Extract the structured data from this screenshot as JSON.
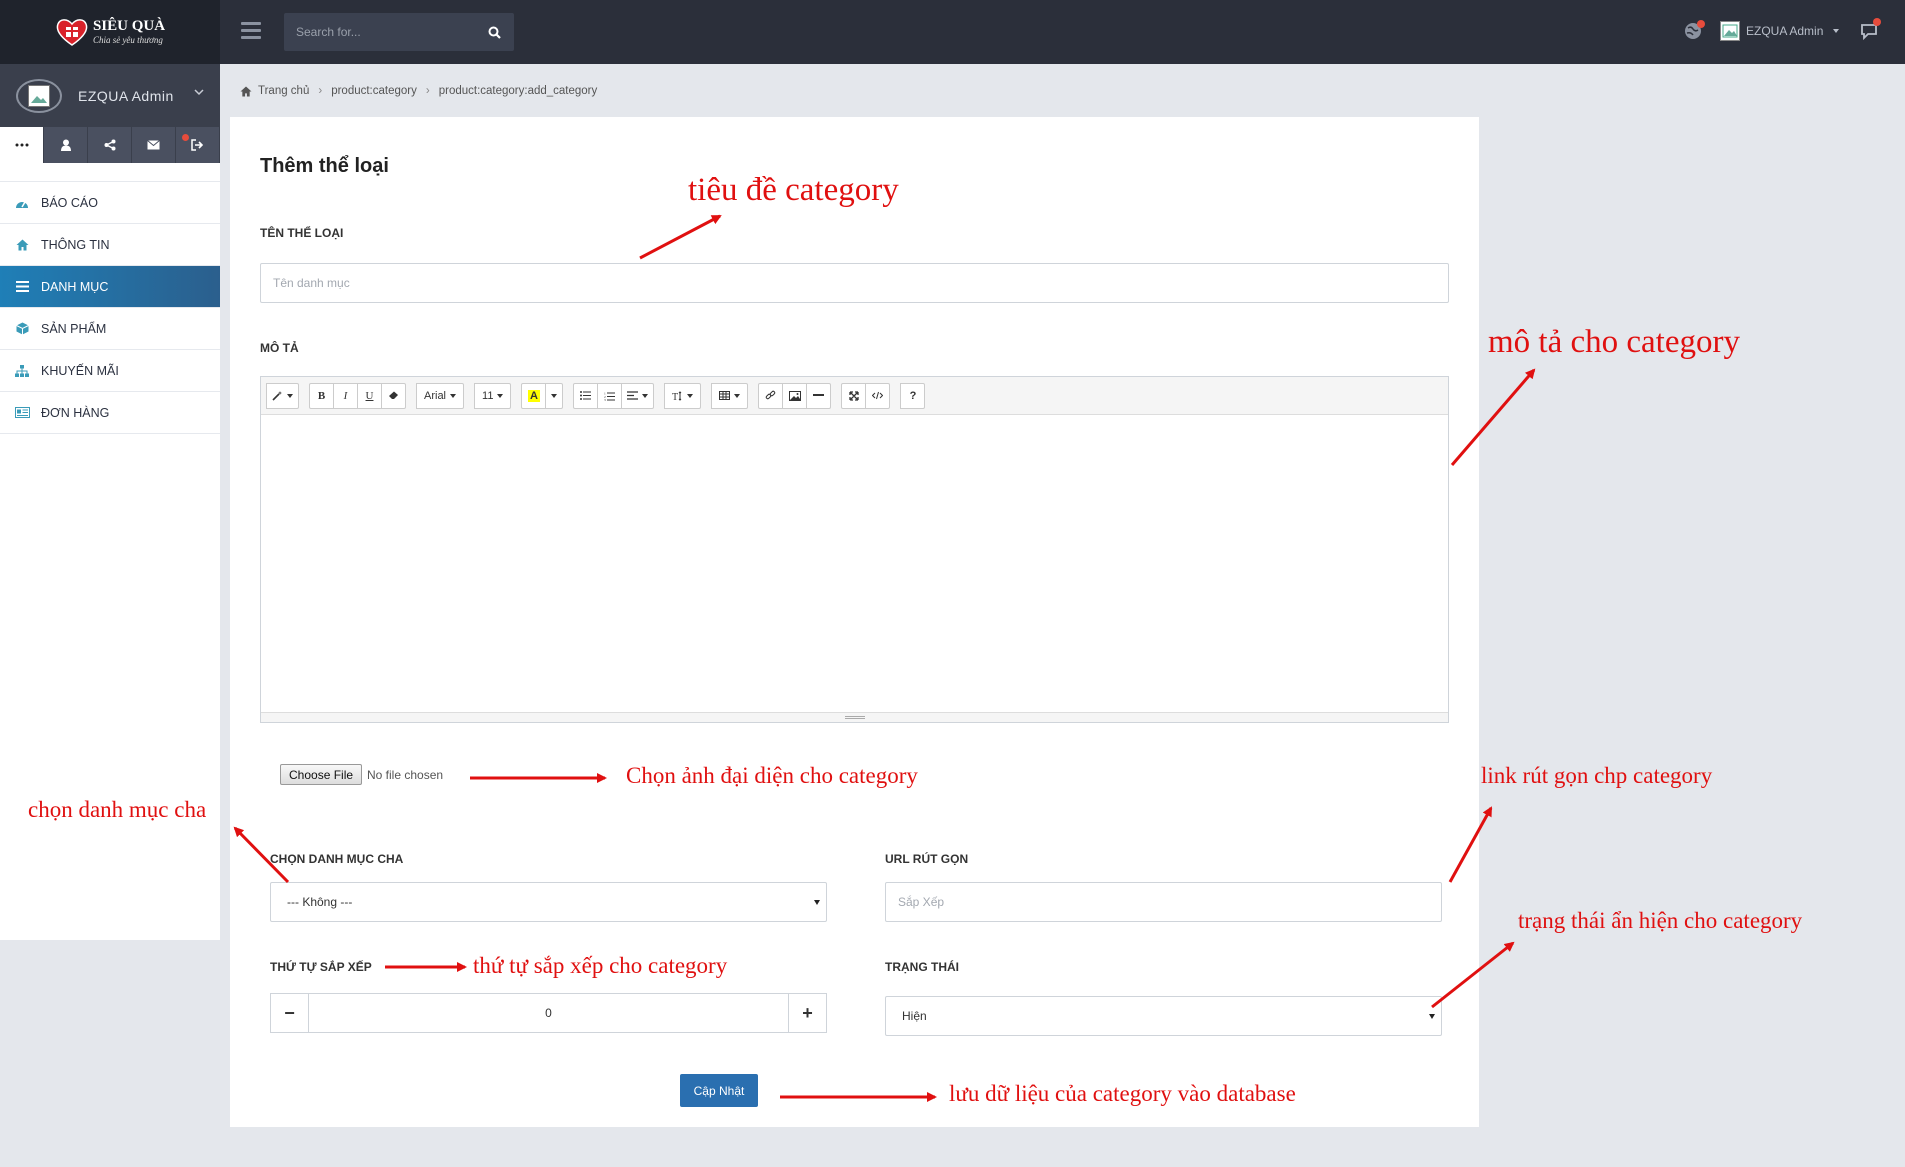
{
  "brand": {
    "name": "SIÊU QUÀ",
    "tagline": "Chia sẻ yêu thương"
  },
  "search": {
    "placeholder": "Search for..."
  },
  "topbar": {
    "user_name": "EZQUA Admin"
  },
  "sidebar": {
    "user_name": "EZQUA Admin",
    "tabs": [
      {
        "icon": "more-dots-icon"
      },
      {
        "icon": "user-icon"
      },
      {
        "icon": "share-icon"
      },
      {
        "icon": "mail-icon"
      },
      {
        "icon": "sign-out-icon"
      }
    ],
    "items": [
      {
        "label": "BÁO CÁO",
        "icon": "dashboard-icon",
        "color": "#3a9bb8"
      },
      {
        "label": "THÔNG TIN",
        "icon": "home-icon",
        "color": "#3a9bb8"
      },
      {
        "label": "DANH MỤC",
        "icon": "list-icon",
        "active": true
      },
      {
        "label": "SẢN PHẨM",
        "icon": "cube-icon",
        "color": "#3a9bb8"
      },
      {
        "label": "KHUYẾN MÃI",
        "icon": "sitemap-icon",
        "color": "#3a9bb8"
      },
      {
        "label": "ĐƠN HÀNG",
        "icon": "newspaper-icon",
        "color": "#3a9bb8"
      }
    ]
  },
  "breadcrumb": {
    "home": "Trang chủ",
    "items": [
      "product:category",
      "product:category:add_category"
    ]
  },
  "form": {
    "title": "Thêm thể loại",
    "name_label": "TÊN THỂ LOẠI",
    "name_placeholder": "Tên danh mục",
    "desc_label": "MÔ TẢ",
    "toolbar": {
      "font": "Arial",
      "size": "11",
      "bold": "B",
      "italic": "I",
      "underline": "U",
      "help": "?"
    },
    "file_button": "Choose File",
    "file_status": "No file chosen",
    "parent_label": "CHỌN DANH MỤC CHA",
    "parent_value": "--- Không ---",
    "url_label": "URL RÚT GỌN",
    "url_placeholder": "Sắp Xếp",
    "order_label": "THỨ TỰ SẮP XẾP",
    "order_value": "0",
    "status_label": "TRẠNG THÁI",
    "status_value": "Hiện",
    "submit_label": "Cập Nhật"
  },
  "annotations": {
    "title": "tiêu đề category",
    "description": "mô tả cho category",
    "image": "Chọn ảnh đại diện cho category",
    "url": "link rút gọn chp category",
    "parent": "chọn danh mục cha",
    "status": "trạng thái ẩn hiện cho category",
    "order": "thứ tự sắp xếp cho category",
    "save": "lưu dữ liệu của category vào database"
  },
  "colors": {
    "accent": "#2a6fb0",
    "annotation": "#e01010",
    "topbar": "#2b2f3a"
  }
}
